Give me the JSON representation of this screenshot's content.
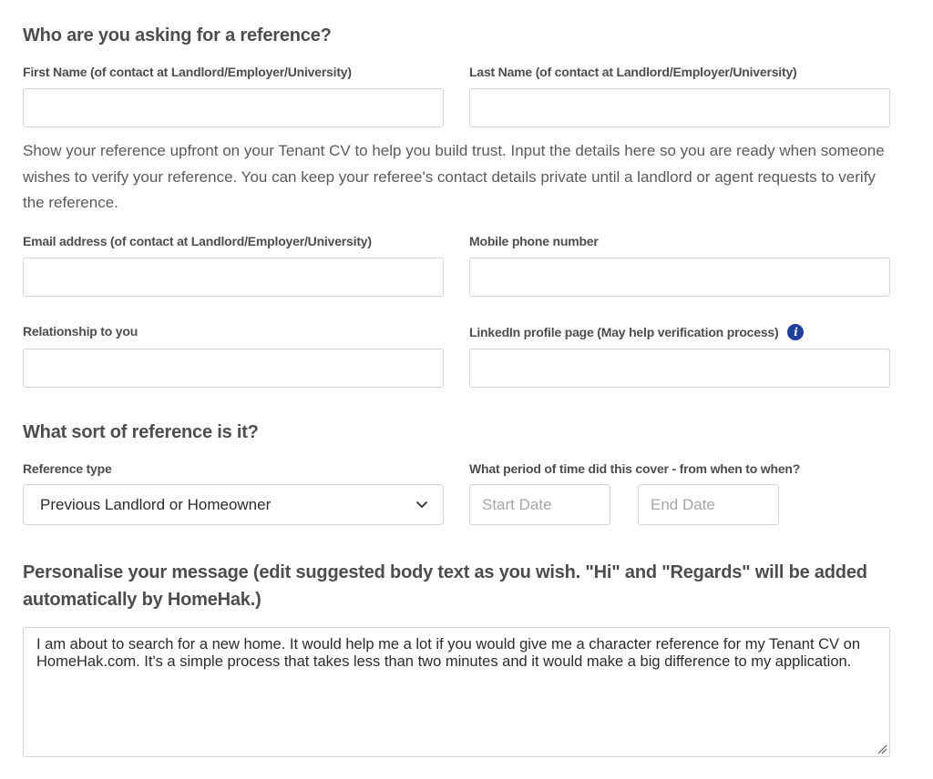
{
  "section_contact": {
    "heading": "Who are you asking for a reference?",
    "first_name_label": "First Name (of contact at Landlord/Employer/University)",
    "first_name_value": "",
    "last_name_label": "Last Name (of contact at Landlord/Employer/University)",
    "last_name_value": "",
    "description": "Show your reference upfront on your Tenant CV to help you build trust. Input the details here so you are ready when someone wishes to verify your reference. You can keep your referee's contact details private until a landlord or agent requests to verify the reference.",
    "email_label": "Email address (of contact at Landlord/Employer/University)",
    "email_value": "",
    "phone_label": "Mobile phone number",
    "phone_value": "",
    "relationship_label": "Relationship to you",
    "relationship_value": "",
    "linkedin_label": "LinkedIn profile page (May help verification process)",
    "linkedin_value": "",
    "info_icon": "info-icon",
    "info_glyph": "i"
  },
  "section_type": {
    "heading": "What sort of reference is it?",
    "reference_type_label": "Reference type",
    "reference_type_selected": "Previous Landlord or Homeowner",
    "period_label": "What period of time did this cover - from when to when?",
    "start_date_placeholder": "Start Date",
    "end_date_placeholder": "End Date"
  },
  "section_message": {
    "heading": "Personalise your message (edit suggested body text as you wish. \"Hi\" and \"Regards\" will be added automatically by HomeHak.)",
    "message_body": "I am about to search for a new home. It would help me a lot if you would give me a character reference for my Tenant CV on HomeHak.com. It's a simple process that takes less than two minutes and it would make a big difference to my application."
  },
  "colors": {
    "info_icon": "#1f3f9e",
    "heading_text": "#4d4d4d",
    "field_border": "#d3d3d3",
    "placeholder": "#a6a6a6"
  }
}
